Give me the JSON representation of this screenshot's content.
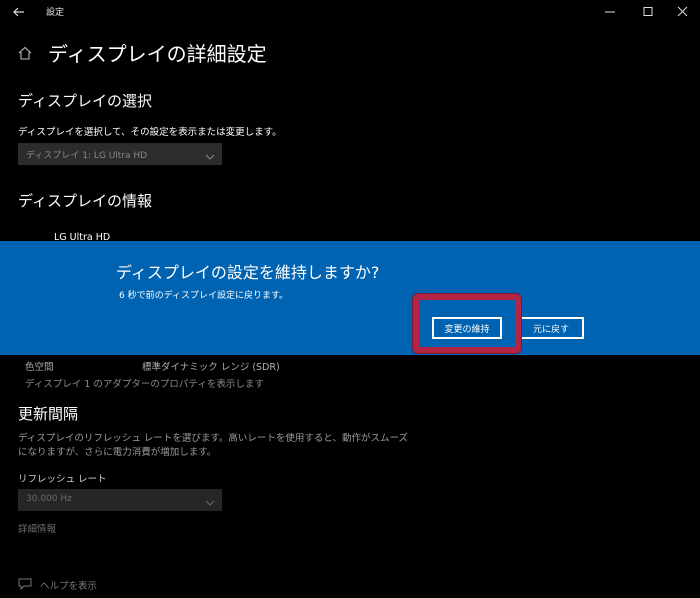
{
  "window": {
    "title": "設定",
    "icons": {
      "back": "back-arrow-icon",
      "minimize": "minimize-icon",
      "maximize": "maximize-icon",
      "close": "close-icon"
    }
  },
  "page": {
    "title": "ディスプレイの詳細設定",
    "home_icon": "home-icon"
  },
  "select_display": {
    "heading": "ディスプレイの選択",
    "description": "ディスプレイを選択して、その設定を表示または変更します。",
    "dropdown_value": "ディスプレイ 1: LG Ultra HD"
  },
  "display_info": {
    "heading": "ディスプレイの情報",
    "display_name": "LG Ultra HD",
    "color_space_label": "色空間",
    "color_space_value": "標準ダイナミック レンジ (SDR)",
    "adapter_link": "ディスプレイ 1 のアダプターのプロパティを表示します"
  },
  "refresh": {
    "heading": "更新間隔",
    "description_line1": "ディスプレイのリフレッシュ レートを選びます。高いレートを使用すると、動作がスムーズ",
    "description_line2": "になりますが、さらに電力消費が増加します。",
    "rate_label": "リフレッシュ レート",
    "rate_value": "30.000 Hz",
    "details_link": "詳細情報"
  },
  "help": {
    "link": "ヘルプを表示",
    "icon": "help-chat-icon"
  },
  "dialog": {
    "title": "ディスプレイの設定を維持しますか?",
    "message": "6 秒で前のディスプレイ設定に戻ります。",
    "keep_button": "変更の維持",
    "revert_button": "元に戻す",
    "highlight_color": "#b32445",
    "background_color": "#0063b1"
  }
}
